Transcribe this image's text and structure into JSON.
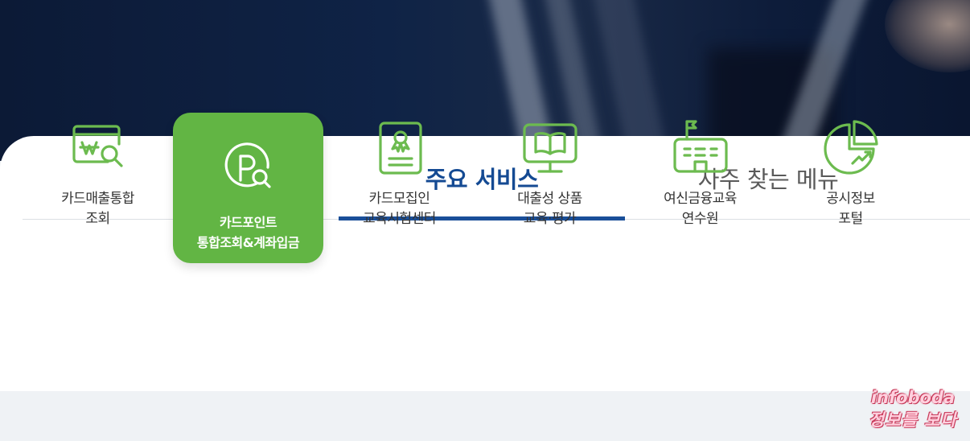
{
  "tabs": {
    "main_services": "주요 서비스",
    "frequent_menu": "자주 찾는 메뉴"
  },
  "services": [
    {
      "line1": "카드매출통합",
      "line2": "조회",
      "icon": "won-search-icon"
    },
    {
      "line1": "카드포인트",
      "line2": "통합조회&계좌입금",
      "icon": "point-search-icon"
    },
    {
      "line1": "카드모집인",
      "line2": "교육시험센터",
      "icon": "certificate-icon"
    },
    {
      "line1": "대출성 상품",
      "line2": "교육·평가",
      "icon": "monitor-book-icon"
    },
    {
      "line1": "여신금융교육",
      "line2": "연수원",
      "icon": "school-building-icon"
    },
    {
      "line1": "공시정보",
      "line2": "포털",
      "icon": "pie-chart-icon"
    }
  ],
  "colors": {
    "brand_blue": "#144a93",
    "accent_green": "#62b544",
    "icon_green": "#6cbb4f"
  },
  "watermark": {
    "line1": "infoboda",
    "line2": "정보를 보다"
  }
}
